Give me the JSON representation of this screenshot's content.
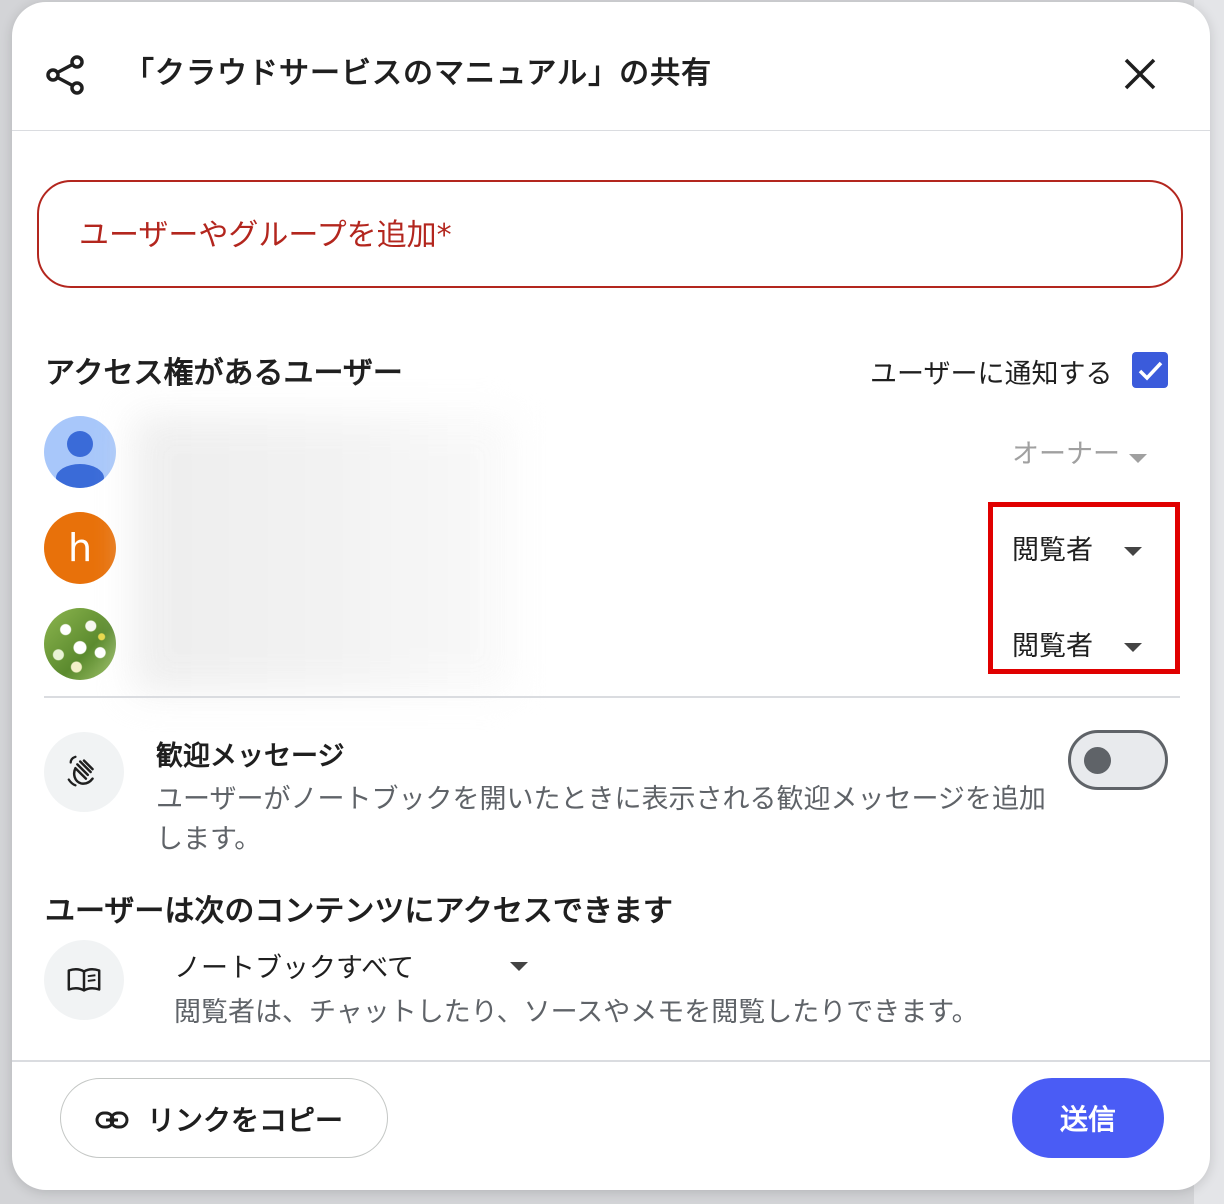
{
  "dialog": {
    "title": "「クラウドサービスのマニュアル」の共有",
    "share_icon": "share-icon",
    "close_icon": "close-icon"
  },
  "add_field": {
    "placeholder": "ユーザーやグループを追加*"
  },
  "access": {
    "heading": "アクセス権があるユーザー",
    "notify_label": "ユーザーに通知する",
    "notify_checked": true,
    "users": [
      {
        "avatar": "person-icon",
        "role": "オーナー"
      },
      {
        "avatar_letter": "h",
        "role": "閲覧者"
      },
      {
        "avatar": "flower-photo",
        "role": "閲覧者"
      }
    ]
  },
  "welcome": {
    "title": "歓迎メッセージ",
    "description": "ユーザーがノートブックを開いたときに表示される歓迎メッセージを追加します。",
    "icon": "wave-hand-icon",
    "enabled": false
  },
  "content": {
    "heading": "ユーザーは次のコンテンツにアクセスできます",
    "scope": "ノートブックすべて",
    "description": "閲覧者は、チャットしたり、ソースやメモを閲覧したりできます。",
    "icon": "book-icon"
  },
  "footer": {
    "copy_link_label": "リンクをコピー",
    "send_label": "送信"
  },
  "colors": {
    "error": "#b3261e",
    "accent": "#4a5cf5",
    "highlight": "#e00000"
  }
}
